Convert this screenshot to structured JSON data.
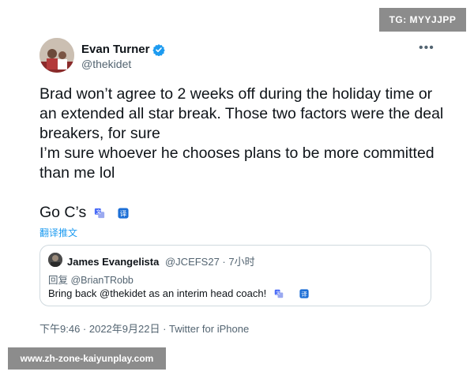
{
  "watermark_top": "TG: MYYJJPP",
  "watermark_bottom": "www.zh-zone-kaiyunplay.com",
  "tweet": {
    "display_name": "Evan Turner",
    "handle": "@thekidet",
    "text": "Brad won’t agree to 2 weeks off during the holiday time or an extended all star break. Those two factors were the deal breakers, for sure\nI’m sure whoever he chooses plans to be more committed than me lol",
    "last_line": "Go C’s",
    "translate_label": "翻译推文",
    "timestamp": "下午9:46 · 2022年9月22日 · Twitter for iPhone",
    "more_icon": "more-horizontal-icon",
    "verified_color": "#1d9bf0"
  },
  "quoted_tweet": {
    "display_name": "James Evangelista",
    "meta": "@JCEFS27 · 7小时",
    "reply_to": "回复 @BrianTRobb",
    "text": "Bring back @thekidet as an interim head coach!"
  },
  "colors": {
    "accent": "#1d9bf0",
    "text": "#0f1419",
    "secondary": "#536471",
    "border": "#cfd9de",
    "watermark_bg": "#8c8c8c"
  }
}
